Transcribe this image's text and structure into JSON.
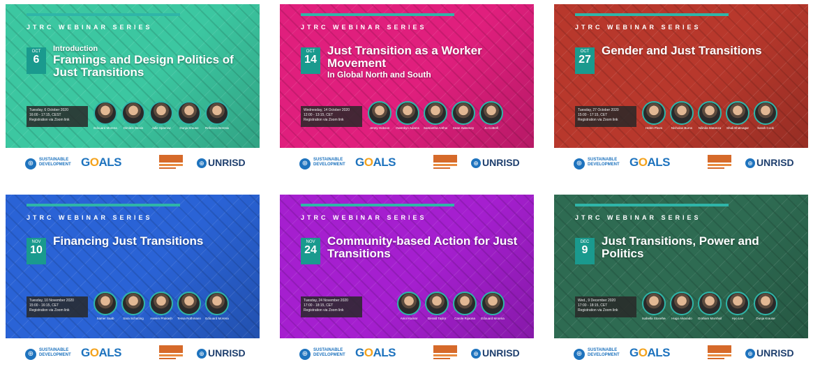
{
  "series_label": "JTRC WEBINAR SERIES",
  "footer": {
    "un_glyph": "⊕",
    "sdg_line1": "SUSTAINABLE",
    "sdg_line2": "DEVELOPMENT",
    "goals_pre": "G",
    "goals_o": "O",
    "goals_post": "ALS",
    "unrisd": "UNRISD"
  },
  "colors": {
    "teal": "#2fb5a8",
    "sdg_blue": "#1e73be",
    "jtrc_orange": "#d66a2a"
  },
  "cards": [
    {
      "bg": "#3cc7a1",
      "month": "OCT",
      "day": "6",
      "pre": "Introduction",
      "title": "Framings and Design Politics of Just Transitions",
      "sub": "",
      "info": [
        "Tuesday, 6 October 2020",
        "16:00 - 17:15, CEST",
        "Registration via Zoom link"
      ],
      "speakers": [
        "Edouard Morena",
        "Dimitris Stevis",
        "Julie Sparrow",
        "Dunja Krause",
        "Rebecca Brennan"
      ]
    },
    {
      "bg": "#e01f7d",
      "month": "OCT",
      "day": "14",
      "pre": "",
      "title": "Just Transition as a Worker Movement",
      "sub": "In Global North and South",
      "info": [
        "Wednesday, 14 October 2020",
        "12:00 - 13:15, CET",
        "Registration via Zoom link"
      ],
      "speakers": [
        "Jenny Hobson",
        "Owenkyn Adams",
        "Samantha Anthony",
        "Sean Sweeney",
        "Jo Cottrell"
      ]
    },
    {
      "bg": "#b8382c",
      "month": "OCT",
      "day": "27",
      "pre": "",
      "title": "Gender and Just Transitions",
      "sub": "",
      "info": [
        "Tuesday, 27 October 2020",
        "15:00 - 17:15, CET",
        "Registration via Zoom link"
      ],
      "speakers": [
        "Helen Pines",
        "Nicholas Burns",
        "Nilinda Matanza",
        "Shali Bhatnagar",
        "Sarah Cook"
      ]
    },
    {
      "bg": "#2a63d6",
      "month": "NOV",
      "day": "10",
      "pre": "",
      "title": "Financing Just Transitions",
      "sub": "",
      "info": [
        "Tuesday, 10 November 2020",
        "15:00 - 16:15, CET",
        "Registration via Zoom link"
      ],
      "speakers": [
        "Samer Saab",
        "Sara Schutting",
        "Aseem Prakash",
        "Tessa Rothmann",
        "Edouard Morena"
      ]
    },
    {
      "bg": "#a51fcf",
      "month": "NOV",
      "day": "24",
      "pre": "",
      "title": "Community-based Action for Just Transitions",
      "sub": "",
      "info": [
        "Tuesday, 24 November 2020",
        "17:00 - 18:15, CET",
        "Registration via Zoom link"
      ],
      "speakers": [
        "Aniol Kumar",
        "Gerald Taylor",
        "Carole Rijaona",
        "Edouard Morena"
      ]
    },
    {
      "bg": "#2e6b52",
      "month": "DEC",
      "day": "9",
      "pre": "",
      "title": "Just Transitions, Power and Politics",
      "sub": "",
      "info": [
        "Wed., 9 December 2020",
        "17:00 - 18:15, CET",
        "Registration via Zoom link"
      ],
      "speakers": [
        "Isabella Stonehead",
        "Hugo Alvarado",
        "Graham Marshall",
        "Hyo Lee",
        "Dunja Krause"
      ]
    }
  ]
}
